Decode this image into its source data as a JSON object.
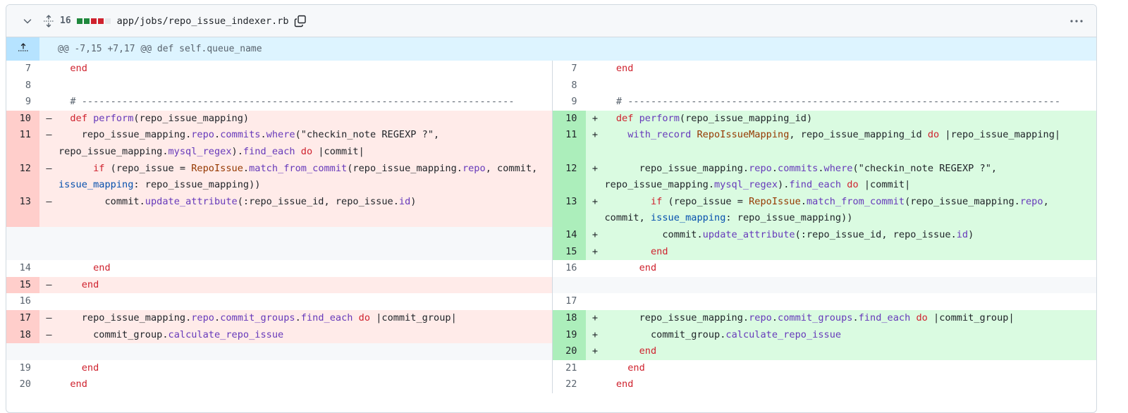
{
  "file_header": {
    "changes_count": "16",
    "diffstat": [
      "added",
      "added",
      "deleted",
      "deleted",
      "neutral"
    ],
    "diffstat_colors": {
      "added": "#1f883d",
      "deleted": "#cf222e",
      "neutral": "#e6e8eb"
    },
    "file_path": "app/jobs/repo_issue_indexer.rb",
    "icons": [
      "chevron-down-icon",
      "unfold-icon",
      "copy-icon",
      "kebab-horizontal-icon"
    ]
  },
  "hunk": {
    "header": "@@ -7,15 +7,17 @@ def self.queue_name",
    "icon": "fold-up-icon"
  },
  "rows": [
    {
      "left": {
        "num": "7",
        "type": "ctx",
        "code": [
          [
            "  ",
            ""
          ],
          [
            "end",
            "kw"
          ]
        ]
      },
      "right": {
        "num": "7",
        "type": "ctx",
        "code": [
          [
            "  ",
            ""
          ],
          [
            "end",
            "kw"
          ]
        ]
      },
      "h": 1
    },
    {
      "left": {
        "num": "8",
        "type": "ctx",
        "code": []
      },
      "right": {
        "num": "8",
        "type": "ctx",
        "code": []
      },
      "h": 1
    },
    {
      "left": {
        "num": "9",
        "type": "ctx",
        "code": [
          [
            "  # ---------------------------------------------------------------------------",
            "cm"
          ]
        ]
      },
      "right": {
        "num": "9",
        "type": "ctx",
        "code": [
          [
            "  # ---------------------------------------------------------------------------",
            "cm"
          ]
        ]
      },
      "h": 1
    },
    {
      "left": {
        "num": "10",
        "type": "del",
        "code": [
          [
            "  ",
            ""
          ],
          [
            "def",
            "kw"
          ],
          [
            " ",
            ""
          ],
          [
            "perform",
            "fn"
          ],
          [
            "(repo_issue_mapping)",
            ""
          ]
        ]
      },
      "right": {
        "num": "10",
        "type": "add",
        "code": [
          [
            "  ",
            ""
          ],
          [
            "def",
            "kw"
          ],
          [
            " ",
            ""
          ],
          [
            "perform",
            "fn"
          ],
          [
            "(repo_issue_mapping_id)",
            ""
          ]
        ]
      },
      "h": 1
    },
    {
      "left": {
        "num": "11",
        "type": "del",
        "code": [
          [
            "    repo_issue_mapping.",
            ""
          ],
          [
            "repo",
            "fn"
          ],
          [
            ".",
            ""
          ],
          [
            "commits",
            "fn"
          ],
          [
            ".",
            ""
          ],
          [
            "where",
            "fn"
          ],
          [
            "(\"checkin_note REGEXP ?\", repo_issue_mapping.",
            ""
          ],
          [
            "mysql_regex",
            "fn"
          ],
          [
            ").",
            ""
          ],
          [
            "find_each",
            "fn"
          ],
          [
            " ",
            ""
          ],
          [
            "do",
            "kw"
          ],
          [
            " |commit|",
            ""
          ]
        ]
      },
      "right": {
        "num": "11",
        "type": "add",
        "code": [
          [
            "    ",
            ""
          ],
          [
            "with_record",
            "fn"
          ],
          [
            " ",
            ""
          ],
          [
            "RepoIssueMapping",
            "cl"
          ],
          [
            ", repo_issue_mapping_id ",
            ""
          ],
          [
            "do",
            "kw"
          ],
          [
            " |repo_issue_mapping|",
            ""
          ]
        ]
      },
      "h": 2
    },
    {
      "left": {
        "num": "12",
        "type": "del",
        "code": [
          [
            "      ",
            ""
          ],
          [
            "if",
            "kw"
          ],
          [
            " (repo_issue = ",
            ""
          ],
          [
            "RepoIssue",
            "cl"
          ],
          [
            ".",
            ""
          ],
          [
            "match_from_commit",
            "fn"
          ],
          [
            "(repo_issue_mapping.",
            ""
          ],
          [
            "repo",
            "fn"
          ],
          [
            ", commit, ",
            ""
          ],
          [
            "issue_mapping",
            "cn"
          ],
          [
            ": repo_issue_mapping))",
            ""
          ]
        ]
      },
      "right": {
        "num": "12",
        "type": "add",
        "code": [
          [
            "      repo_issue_mapping.",
            ""
          ],
          [
            "repo",
            "fn"
          ],
          [
            ".",
            ""
          ],
          [
            "commits",
            "fn"
          ],
          [
            ".",
            ""
          ],
          [
            "where",
            "fn"
          ],
          [
            "(\"checkin_note REGEXP ?\", repo_issue_mapping.",
            ""
          ],
          [
            "mysql_regex",
            "fn"
          ],
          [
            ").",
            ""
          ],
          [
            "find_each",
            "fn"
          ],
          [
            " ",
            ""
          ],
          [
            "do",
            "kw"
          ],
          [
            " |commit|",
            ""
          ]
        ]
      },
      "h": 2
    },
    {
      "left": {
        "num": "13",
        "type": "del",
        "code": [
          [
            "        commit.",
            ""
          ],
          [
            "update_attribute",
            "fn"
          ],
          [
            "(:repo_issue_id, repo_issue.",
            ""
          ],
          [
            "id",
            "fn"
          ],
          [
            ")",
            ""
          ]
        ]
      },
      "right": {
        "num": "13",
        "type": "add",
        "code": [
          [
            "        ",
            ""
          ],
          [
            "if",
            "kw"
          ],
          [
            " (repo_issue = ",
            ""
          ],
          [
            "RepoIssue",
            "cl"
          ],
          [
            ".",
            ""
          ],
          [
            "match_from_commit",
            "fn"
          ],
          [
            "(repo_issue_mapping.",
            ""
          ],
          [
            "repo",
            "fn"
          ],
          [
            ", commit, ",
            ""
          ],
          [
            "issue_mapping",
            "cn"
          ],
          [
            ": repo_issue_mapping))",
            ""
          ]
        ]
      },
      "h": 2
    },
    {
      "left": {
        "num": "",
        "type": "empty",
        "code": []
      },
      "right": {
        "num": "14",
        "type": "add",
        "code": [
          [
            "          commit.",
            ""
          ],
          [
            "update_attribute",
            "fn"
          ],
          [
            "(:repo_issue_id, repo_issue.",
            ""
          ],
          [
            "id",
            "fn"
          ],
          [
            ")",
            ""
          ]
        ]
      },
      "h": 1
    },
    {
      "left": {
        "num": "",
        "type": "empty",
        "code": []
      },
      "right": {
        "num": "15",
        "type": "add",
        "code": [
          [
            "        ",
            ""
          ],
          [
            "end",
            "kw"
          ]
        ]
      },
      "h": 1
    },
    {
      "left": {
        "num": "14",
        "type": "ctx",
        "code": [
          [
            "      ",
            ""
          ],
          [
            "end",
            "kw"
          ]
        ]
      },
      "right": {
        "num": "16",
        "type": "ctx",
        "code": [
          [
            "      ",
            ""
          ],
          [
            "end",
            "kw"
          ]
        ]
      },
      "h": 1
    },
    {
      "left": {
        "num": "15",
        "type": "del",
        "code": [
          [
            "    ",
            ""
          ],
          [
            "end",
            "kw"
          ]
        ]
      },
      "right": {
        "num": "",
        "type": "empty",
        "code": []
      },
      "h": 1
    },
    {
      "left": {
        "num": "16",
        "type": "ctx",
        "code": []
      },
      "right": {
        "num": "17",
        "type": "ctx",
        "code": []
      },
      "h": 1
    },
    {
      "left": {
        "num": "17",
        "type": "del",
        "code": [
          [
            "    repo_issue_mapping.",
            ""
          ],
          [
            "repo",
            "fn"
          ],
          [
            ".",
            ""
          ],
          [
            "commit_groups",
            "fn"
          ],
          [
            ".",
            ""
          ],
          [
            "find_each",
            "fn"
          ],
          [
            " ",
            ""
          ],
          [
            "do",
            "kw"
          ],
          [
            " |commit_group|",
            ""
          ]
        ]
      },
      "right": {
        "num": "18",
        "type": "add",
        "code": [
          [
            "      repo_issue_mapping.",
            ""
          ],
          [
            "repo",
            "fn"
          ],
          [
            ".",
            ""
          ],
          [
            "commit_groups",
            "fn"
          ],
          [
            ".",
            ""
          ],
          [
            "find_each",
            "fn"
          ],
          [
            " ",
            ""
          ],
          [
            "do",
            "kw"
          ],
          [
            " |commit_group|",
            ""
          ]
        ]
      },
      "h": 1
    },
    {
      "left": {
        "num": "18",
        "type": "del",
        "code": [
          [
            "      commit_group.",
            ""
          ],
          [
            "calculate_repo_issue",
            "fn"
          ]
        ]
      },
      "right": {
        "num": "19",
        "type": "add",
        "code": [
          [
            "        commit_group.",
            ""
          ],
          [
            "calculate_repo_issue",
            "fn"
          ]
        ]
      },
      "h": 1
    },
    {
      "left": {
        "num": "",
        "type": "empty",
        "code": []
      },
      "right": {
        "num": "20",
        "type": "add",
        "code": [
          [
            "      ",
            ""
          ],
          [
            "end",
            "kw"
          ]
        ]
      },
      "h": 1
    },
    {
      "left": {
        "num": "19",
        "type": "ctx",
        "code": [
          [
            "    ",
            ""
          ],
          [
            "end",
            "kw"
          ]
        ]
      },
      "right": {
        "num": "21",
        "type": "ctx",
        "code": [
          [
            "    ",
            ""
          ],
          [
            "end",
            "kw"
          ]
        ]
      },
      "h": 1
    },
    {
      "left": {
        "num": "20",
        "type": "ctx",
        "code": [
          [
            "  ",
            ""
          ],
          [
            "end",
            "kw"
          ]
        ]
      },
      "right": {
        "num": "22",
        "type": "ctx",
        "code": [
          [
            "  ",
            ""
          ],
          [
            "end",
            "kw"
          ]
        ]
      },
      "h": 1
    }
  ]
}
